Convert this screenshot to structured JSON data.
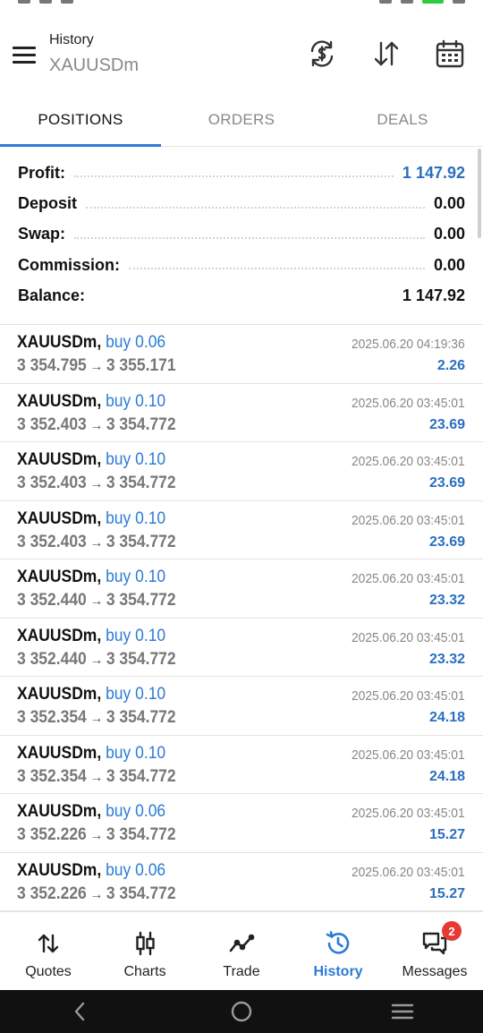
{
  "header": {
    "title": "History",
    "subtitle": "XAUUSDm"
  },
  "tabs": [
    {
      "label": "POSITIONS",
      "active": true
    },
    {
      "label": "ORDERS",
      "active": false
    },
    {
      "label": "DEALS",
      "active": false
    }
  ],
  "summary": [
    {
      "label": "Profit:",
      "value": "1 147.92",
      "highlight": true
    },
    {
      "label": "Deposit",
      "value": "0.00",
      "highlight": false
    },
    {
      "label": "Swap:",
      "value": "0.00",
      "highlight": false
    },
    {
      "label": "Commission:",
      "value": "0.00",
      "highlight": false
    },
    {
      "label": "Balance:",
      "value": "1 147.92",
      "highlight": false
    }
  ],
  "deals": [
    {
      "symbol": "XAUUSDm,",
      "direction": "buy 0.06",
      "open": "3 354.795",
      "close": "3 355.171",
      "time": "2025.06.20 04:19:36",
      "profit": "2.26"
    },
    {
      "symbol": "XAUUSDm,",
      "direction": "buy 0.10",
      "open": "3 352.403",
      "close": "3 354.772",
      "time": "2025.06.20 03:45:01",
      "profit": "23.69"
    },
    {
      "symbol": "XAUUSDm,",
      "direction": "buy 0.10",
      "open": "3 352.403",
      "close": "3 354.772",
      "time": "2025.06.20 03:45:01",
      "profit": "23.69"
    },
    {
      "symbol": "XAUUSDm,",
      "direction": "buy 0.10",
      "open": "3 352.403",
      "close": "3 354.772",
      "time": "2025.06.20 03:45:01",
      "profit": "23.69"
    },
    {
      "symbol": "XAUUSDm,",
      "direction": "buy 0.10",
      "open": "3 352.440",
      "close": "3 354.772",
      "time": "2025.06.20 03:45:01",
      "profit": "23.32"
    },
    {
      "symbol": "XAUUSDm,",
      "direction": "buy 0.10",
      "open": "3 352.440",
      "close": "3 354.772",
      "time": "2025.06.20 03:45:01",
      "profit": "23.32"
    },
    {
      "symbol": "XAUUSDm,",
      "direction": "buy 0.10",
      "open": "3 352.354",
      "close": "3 354.772",
      "time": "2025.06.20 03:45:01",
      "profit": "24.18"
    },
    {
      "symbol": "XAUUSDm,",
      "direction": "buy 0.10",
      "open": "3 352.354",
      "close": "3 354.772",
      "time": "2025.06.20 03:45:01",
      "profit": "24.18"
    },
    {
      "symbol": "XAUUSDm,",
      "direction": "buy 0.06",
      "open": "3 352.226",
      "close": "3 354.772",
      "time": "2025.06.20 03:45:01",
      "profit": "15.27"
    },
    {
      "symbol": "XAUUSDm,",
      "direction": "buy 0.06",
      "open": "3 352.226",
      "close": "3 354.772",
      "time": "2025.06.20 03:45:01",
      "profit": "15.27"
    }
  ],
  "arrow_glyph": "→",
  "bottom_nav": [
    {
      "label": "Quotes",
      "icon": "quotes-arrows-icon",
      "active": false
    },
    {
      "label": "Charts",
      "icon": "candlestick-icon",
      "active": false
    },
    {
      "label": "Trade",
      "icon": "trade-line-icon",
      "active": false
    },
    {
      "label": "History",
      "icon": "history-clock-icon",
      "active": true
    },
    {
      "label": "Messages",
      "icon": "messages-icon",
      "active": false,
      "badge": "2"
    }
  ],
  "colors": {
    "accent": "#2b7bd6",
    "profit_blue": "#2b6fc0",
    "badge_red": "#e53935"
  }
}
